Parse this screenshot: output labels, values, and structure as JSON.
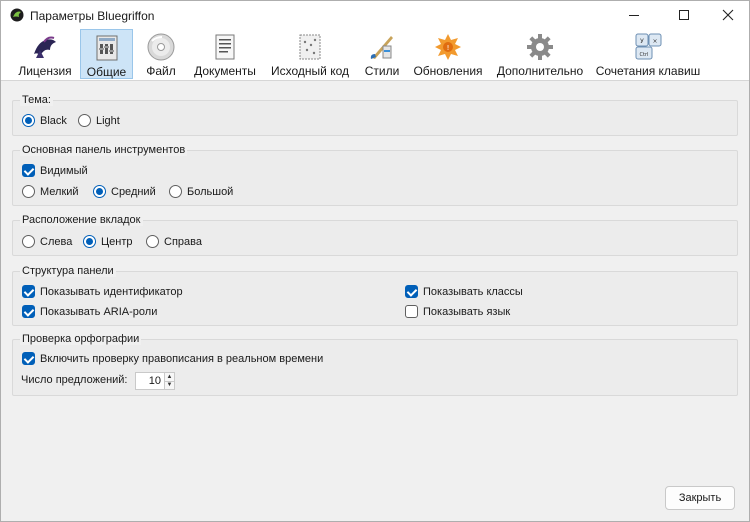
{
  "window": {
    "title": "Параметры Bluegriffon",
    "controls": [
      "minimize",
      "maximize",
      "close"
    ]
  },
  "toolbar": {
    "selected": "Общие",
    "items": [
      {
        "label": "Лицензия",
        "icon": "license-icon"
      },
      {
        "label": "Общие",
        "icon": "general-icon"
      },
      {
        "label": "Файл",
        "icon": "file-disc-icon"
      },
      {
        "label": "Документы",
        "icon": "documents-icon"
      },
      {
        "label": "Исходный код",
        "icon": "source-code-icon"
      },
      {
        "label": "Стили",
        "icon": "styles-icon"
      },
      {
        "label": "Обновления",
        "icon": "updates-icon"
      },
      {
        "label": "Дополнительно",
        "icon": "advanced-gear-icon"
      },
      {
        "label": "Сочетания клавиш",
        "icon": "keyboard-shortcuts-icon"
      }
    ]
  },
  "theme": {
    "legend": "Тема:",
    "options": [
      {
        "label": "Black",
        "selected": true
      },
      {
        "label": "Light",
        "selected": false
      }
    ]
  },
  "main_toolbar": {
    "legend": "Основная панель инструментов",
    "visible_label": "Видимый",
    "visible_checked": true,
    "size_options": [
      {
        "label": "Мелкий",
        "selected": false
      },
      {
        "label": "Средний",
        "selected": true
      },
      {
        "label": "Большой",
        "selected": false
      }
    ]
  },
  "tabs_position": {
    "legend": "Расположение вкладок",
    "options": [
      {
        "label": "Слева",
        "selected": false
      },
      {
        "label": "Центр",
        "selected": true
      },
      {
        "label": "Справа",
        "selected": false
      }
    ]
  },
  "panel_structure": {
    "legend": "Структура панели",
    "options": [
      {
        "label": "Показывать идентификатор",
        "checked": true
      },
      {
        "label": "Показывать ARIA-роли",
        "checked": true
      },
      {
        "label": "Показывать классы",
        "checked": true
      },
      {
        "label": "Показывать язык",
        "checked": false
      }
    ]
  },
  "spellcheck": {
    "legend": "Проверка орфографии",
    "realtime_label": "Включить проверку правописания в реальном времени",
    "realtime_checked": true,
    "suggestions_label": "Число предложений:",
    "suggestions_value": "10"
  },
  "footer": {
    "close_label": "Закрыть"
  },
  "colors": {
    "accent": "#005fb8",
    "selected_tab_bg": "#cde4f7"
  }
}
